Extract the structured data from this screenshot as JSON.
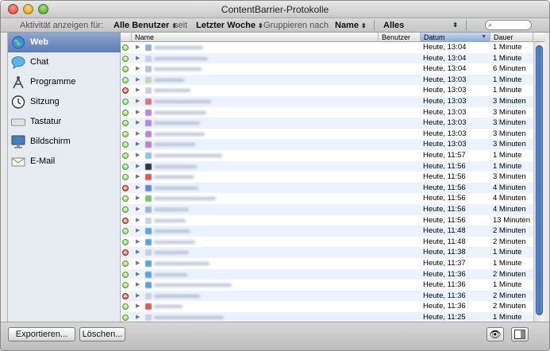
{
  "window": {
    "title": "ContentBarrier-Protokolle"
  },
  "filter": {
    "activity_label": "Aktivität anzeigen für:",
    "user_value": "Alle Benutzer",
    "since_label": "seit",
    "period_value": "Letzter Woche",
    "group_label": "Gruppieren nach",
    "group_value": "Name",
    "type_value": "Alles",
    "search_placeholder": ""
  },
  "sidebar": {
    "items": [
      {
        "label": "Web",
        "icon": "globe-icon",
        "selected": true
      },
      {
        "label": "Chat",
        "icon": "speech-bubble-icon"
      },
      {
        "label": "Programme",
        "icon": "compass-tool-icon"
      },
      {
        "label": "Sitzung",
        "icon": "clock-icon"
      },
      {
        "label": "Tastatur",
        "icon": "keyboard-icon"
      },
      {
        "label": "Bildschirm",
        "icon": "monitor-icon"
      },
      {
        "label": "E-Mail",
        "icon": "envelope-icon"
      }
    ]
  },
  "table": {
    "columns": {
      "name": "Name",
      "user": "Benutzer",
      "date": "Datum",
      "duration": "Dauer"
    },
    "rows": [
      {
        "status": "allowed",
        "date": "Heute, 13:04",
        "duration": "1 Minute",
        "favicon": "#8faecf"
      },
      {
        "status": "allowed",
        "date": "Heute, 13:04",
        "duration": "1 Minute",
        "favicon": "#c9d3e0"
      },
      {
        "status": "allowed",
        "date": "Heute, 13:04",
        "duration": "6 Minuten",
        "favicon": "#b4c4d8"
      },
      {
        "status": "allowed",
        "date": "Heute, 13:03",
        "duration": "1 Minute",
        "favicon": "#c6d8a8"
      },
      {
        "status": "blocked",
        "date": "Heute, 13:03",
        "duration": "1 Minute",
        "favicon": "#c9d3e0"
      },
      {
        "status": "allowed",
        "date": "Heute, 13:03",
        "duration": "3 Minuten",
        "favicon": "#d47a7a"
      },
      {
        "status": "allowed",
        "date": "Heute, 13:03",
        "duration": "3 Minuten",
        "favicon": "#b089d0"
      },
      {
        "status": "allowed",
        "date": "Heute, 13:03",
        "duration": "3 Minuten",
        "favicon": "#b089d0"
      },
      {
        "status": "allowed",
        "date": "Heute, 13:03",
        "duration": "3 Minuten",
        "favicon": "#b089d0"
      },
      {
        "status": "allowed",
        "date": "Heute, 13:03",
        "duration": "3 Minuten",
        "favicon": "#b089d0"
      },
      {
        "status": "allowed",
        "date": "Heute, 11:57",
        "duration": "1 Minute",
        "favicon": "#8fc0e8"
      },
      {
        "status": "allowed",
        "date": "Heute, 11:56",
        "duration": "1 Minute",
        "favicon": "#333333"
      },
      {
        "status": "allowed",
        "date": "Heute, 11:56",
        "duration": "3 Minuten",
        "favicon": "#d65c5c"
      },
      {
        "status": "blocked",
        "date": "Heute, 11:56",
        "duration": "4 Minuten",
        "favicon": "#5a8fd6"
      },
      {
        "status": "allowed",
        "date": "Heute, 11:56",
        "duration": "4 Minuten",
        "favicon": "#7cbf6a"
      },
      {
        "status": "allowed",
        "date": "Heute, 11:56",
        "duration": "4 Minuten",
        "favicon": "#a0b4d0"
      },
      {
        "status": "blocked",
        "date": "Heute, 11:56",
        "duration": "13 Minuten",
        "favicon": "#c9d3e0"
      },
      {
        "status": "allowed",
        "date": "Heute, 11:48",
        "duration": "2 Minuten",
        "favicon": "#5aa3e0"
      },
      {
        "status": "allowed",
        "date": "Heute, 11:48",
        "duration": "2 Minuten",
        "favicon": "#5aa3e0"
      },
      {
        "status": "blocked",
        "date": "Heute, 11:38",
        "duration": "1 Minute",
        "favicon": "#c9d3e0"
      },
      {
        "status": "allowed",
        "date": "Heute, 11:37",
        "duration": "1 Minute",
        "favicon": "#5aa3e0"
      },
      {
        "status": "allowed",
        "date": "Heute, 11:36",
        "duration": "2 Minuten",
        "favicon": "#5aa3e0"
      },
      {
        "status": "allowed",
        "date": "Heute, 11:36",
        "duration": "1 Minute",
        "favicon": "#5aa3e0"
      },
      {
        "status": "blocked",
        "date": "Heute, 11:36",
        "duration": "2 Minuten",
        "favicon": "#c9d3e0"
      },
      {
        "status": "allowed",
        "date": "Heute, 11:36",
        "duration": "2 Minuten",
        "favicon": "#d65c5c"
      },
      {
        "status": "allowed",
        "date": "Heute, 11:25",
        "duration": "1 Minute",
        "favicon": "#c9d3e0"
      }
    ]
  },
  "bottom": {
    "export_label": "Exportieren...",
    "delete_label": "Löschen..."
  }
}
